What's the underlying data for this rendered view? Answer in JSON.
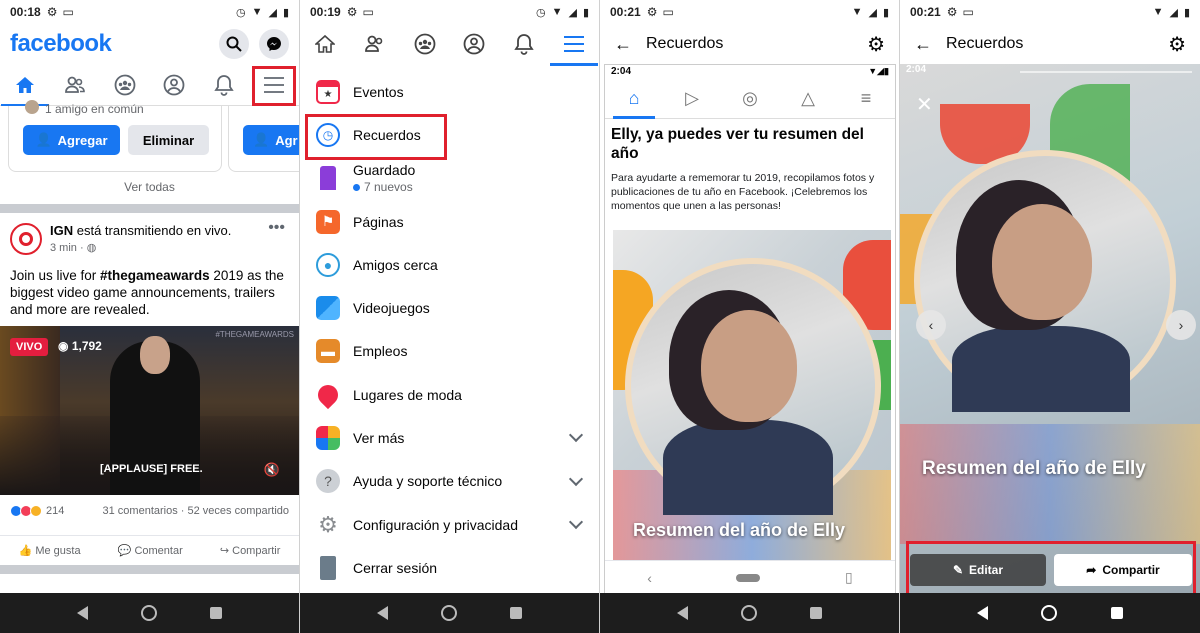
{
  "colors": {
    "brand": "#1877f2",
    "highlight": "#e0202d",
    "live": "#e41e3f"
  },
  "panel1": {
    "status_time": "00:18",
    "logo": "facebook",
    "icons": [
      "search-icon",
      "messenger-icon",
      "home-icon",
      "friends-icon",
      "groups-icon",
      "profile-icon",
      "bell-icon",
      "menu-icon"
    ],
    "suggestion": {
      "mutual": "1 amigo en común",
      "add_label": "Agregar",
      "remove_label": "Eliminar",
      "add_label_2": "Agr"
    },
    "see_all": "Ver todas",
    "post": {
      "author": "IGN",
      "action": "está transmitiendo en vivo.",
      "time": "3 min · ",
      "text_before": "Join us live for ",
      "hashtag": "#thegameawards",
      "text_after": " 2019 as the biggest video game announcements, trailers and more are revealed.",
      "live_badge": "VIVO",
      "viewers": "1,792",
      "caption": "[APPLAUSE] FREE.",
      "watermark": "#THEGAMEAWARDS",
      "reactions": "214",
      "comments": "31 comentarios · 52 veces compartido",
      "like": "Me gusta",
      "comment": "Comentar",
      "share": "Compartir"
    }
  },
  "panel2": {
    "status_time": "00:19",
    "menu": [
      {
        "label": "Eventos",
        "icon": "calendar-icon",
        "color": "#f02849",
        "sub": ""
      },
      {
        "label": "Recuerdos",
        "icon": "clock-icon",
        "color": "#1877f2",
        "sub": ""
      },
      {
        "label": "Guardado",
        "icon": "bookmark-icon",
        "color": "#8b3dd9",
        "sub": "7 nuevos"
      },
      {
        "label": "Páginas",
        "icon": "flag-icon",
        "color": "#f5672b",
        "sub": ""
      },
      {
        "label": "Amigos cerca",
        "icon": "nearby-icon",
        "color": "#2d9cdb",
        "sub": ""
      },
      {
        "label": "Videojuegos",
        "icon": "gamepad-icon",
        "color": "#1a8ceb",
        "sub": ""
      },
      {
        "label": "Empleos",
        "icon": "briefcase-icon",
        "color": "#e58a2a",
        "sub": ""
      },
      {
        "label": "Lugares de moda",
        "icon": "pin-icon",
        "color": "#f02849",
        "sub": ""
      },
      {
        "label": "Ver más",
        "icon": "apps-icon",
        "color": "#45bd62",
        "sub": ""
      },
      {
        "label": "Ayuda y soporte técnico",
        "icon": "help-icon",
        "color": "#8a8d91",
        "sub": ""
      },
      {
        "label": "Configuración y privacidad",
        "icon": "gear-icon",
        "color": "#8a8d91",
        "sub": ""
      },
      {
        "label": "Cerrar sesión",
        "icon": "door-icon",
        "color": "#6b7c8a",
        "sub": ""
      }
    ]
  },
  "panel3": {
    "status_time": "00:21",
    "title": "Recuerdos",
    "inner_time": "2:04",
    "headline": "Elly, ya puedes ver tu resumen del año",
    "description": "Para ayudarte a rememorar tu 2019, recopilamos fotos y publicaciones de tu año en Facebook. ¡Celebremos los momentos que unen a las personas!",
    "recap_title": "Resumen del año de Elly"
  },
  "panel4": {
    "status_time": "00:21",
    "title": "Recuerdos",
    "inner_time": "2:04",
    "recap_title": "Resumen del año de Elly",
    "edit_label": "Editar",
    "share_label": "Compartir"
  }
}
